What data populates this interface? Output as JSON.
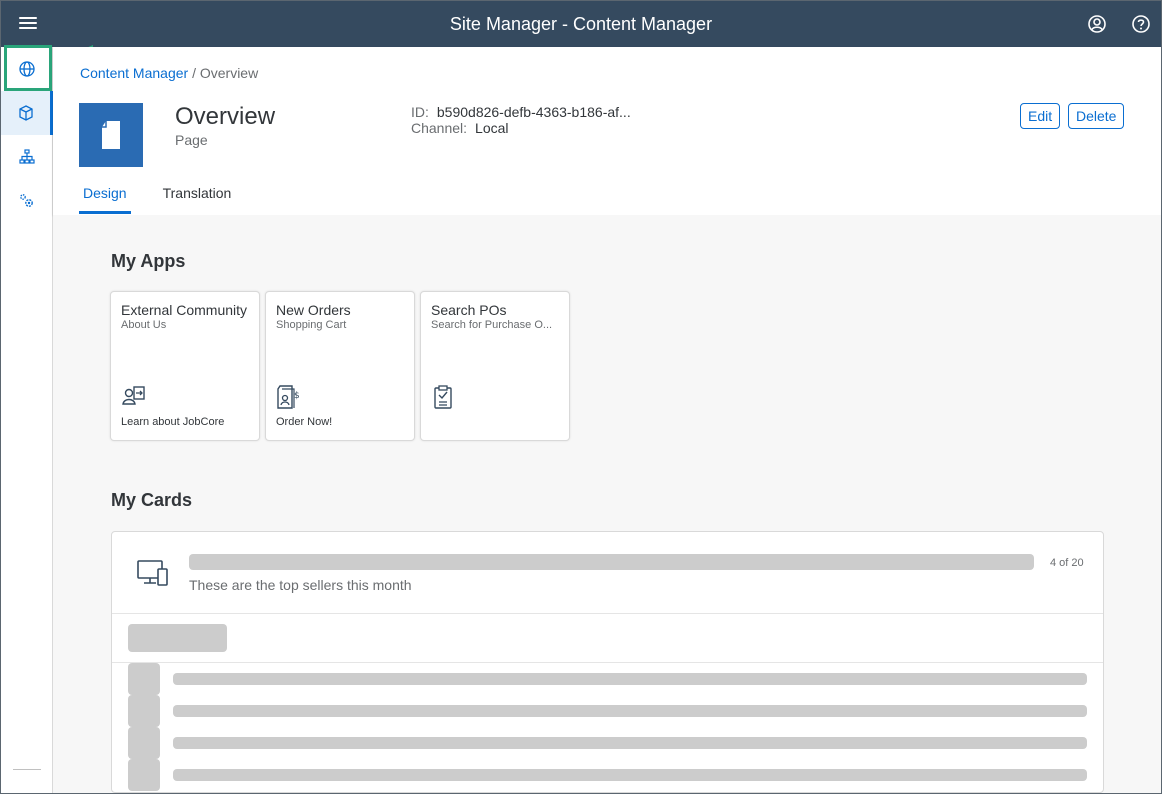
{
  "shell": {
    "title": "Site Manager - Content Manager",
    "menu_icon": "hamburger-icon",
    "user_icon": "user-icon",
    "help_icon": "help-icon"
  },
  "rail": {
    "items": [
      {
        "icon": "globe-icon"
      },
      {
        "icon": "cube-icon"
      },
      {
        "icon": "hierarchy-icon"
      },
      {
        "icon": "settings-icon"
      }
    ]
  },
  "colors": {
    "shell_bg": "#354a5f",
    "accent": "#0a6ed1",
    "highlight": "#2aa57a",
    "page_icon_bg": "#2a6bb3"
  },
  "breadcrumb": {
    "link": "Content Manager",
    "separator": " / ",
    "current": "Overview"
  },
  "object": {
    "title": "Overview",
    "subtitle": "Page",
    "id_label": "ID:",
    "id_value": "b590d826-defb-4363-b186-af...",
    "channel_label": "Channel:",
    "channel_value": "Local"
  },
  "actions": {
    "edit": "Edit",
    "delete": "Delete"
  },
  "tabs": [
    {
      "label": "Design",
      "active": true
    },
    {
      "label": "Translation",
      "active": false
    }
  ],
  "my_apps": {
    "title": "My Apps",
    "tiles": [
      {
        "title": "External Community",
        "subtitle": "About Us",
        "footer": "Learn about JobCore",
        "icon": "person-arrow-icon"
      },
      {
        "title": "New Orders",
        "subtitle": "Shopping Cart",
        "footer": "Order Now!",
        "icon": "sales-document-icon"
      },
      {
        "title": "Search POs",
        "subtitle": "Search for Purchase O...",
        "footer": "",
        "icon": "clipboard-check-icon"
      }
    ]
  },
  "my_cards": {
    "title": "My Cards",
    "card": {
      "subtitle": "These are the top sellers this month",
      "count": "4 of 20",
      "icon": "devices-icon"
    }
  }
}
